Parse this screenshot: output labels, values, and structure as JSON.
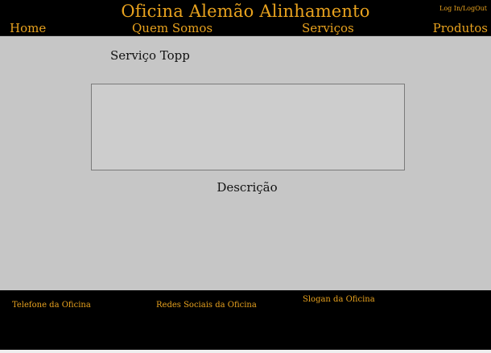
{
  "header": {
    "site_title": "Oficina Alemão Alinhamento",
    "login_label": "Log In/LogOut",
    "nav": {
      "home": "Home",
      "about": "Quem Somos",
      "services": "Serviços",
      "products": "Produtos"
    }
  },
  "main": {
    "service_name": "Serviço Topp",
    "description": "Descrição"
  },
  "footer": {
    "phone": "Telefone da Oficina",
    "social": "Redes Sociais da Oficina",
    "slogan": "Slogan da Oficina"
  },
  "colors": {
    "accent": "#e8a21e",
    "header_background": "#000000",
    "page_background": "#c6c6c6"
  }
}
